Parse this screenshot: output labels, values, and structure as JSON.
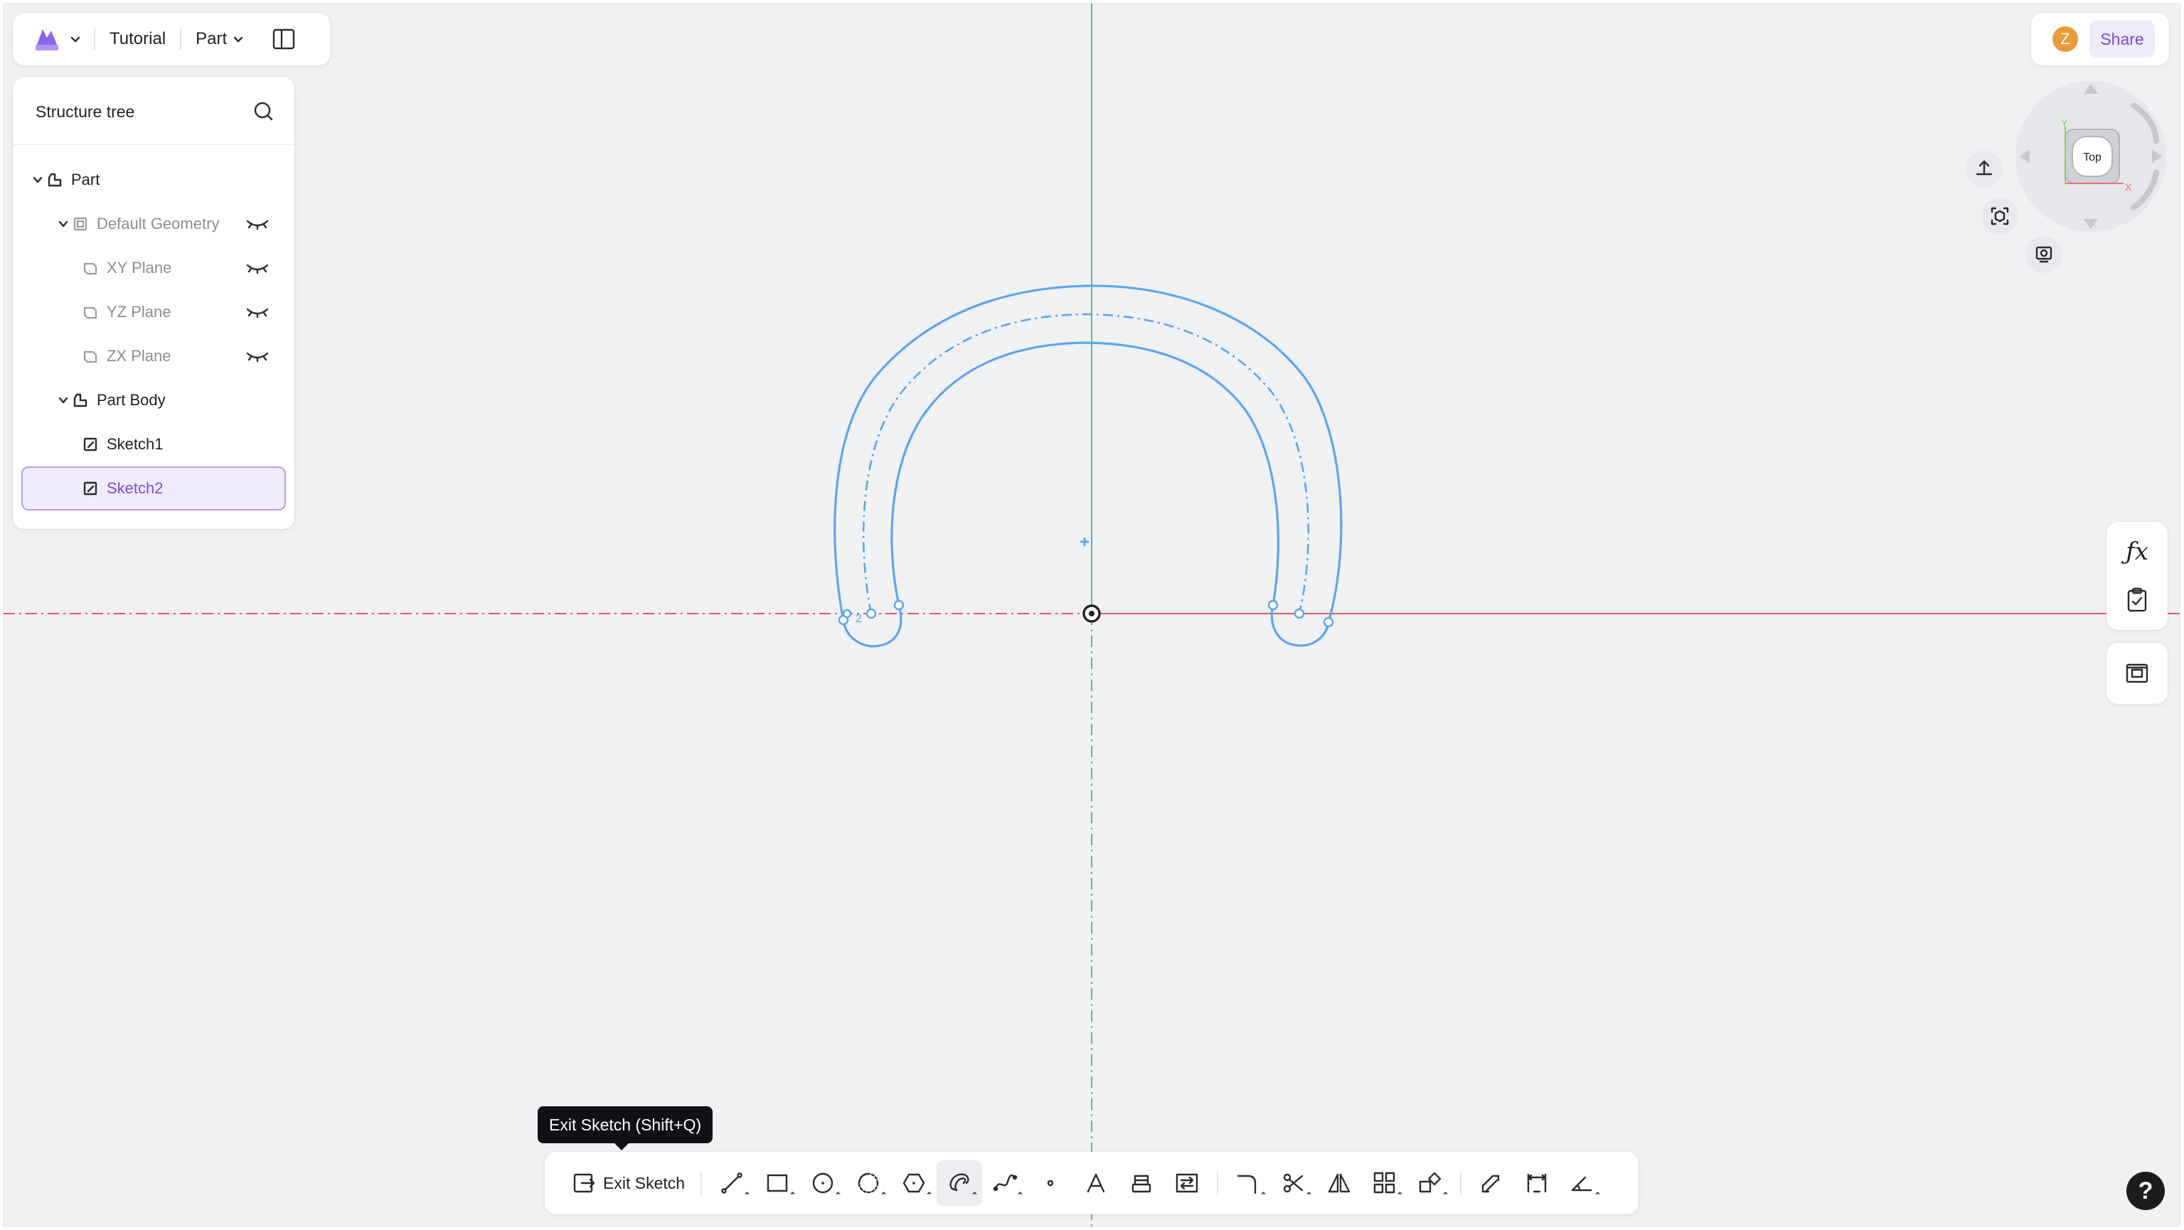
{
  "topbar": {
    "app_logo": "app-logo",
    "project_title": "Tutorial",
    "mode_label": "Part"
  },
  "tree": {
    "title": "Structure tree",
    "items": [
      {
        "label": "Part",
        "icon": "part-icon",
        "expanded": true
      },
      {
        "label": "Default Geometry",
        "icon": "geometry-icon",
        "expanded": true,
        "hidden": true
      },
      {
        "label": "XY Plane",
        "icon": "plane-icon",
        "hidden": true
      },
      {
        "label": "YZ Plane",
        "icon": "plane-icon",
        "hidden": true
      },
      {
        "label": "ZX Plane",
        "icon": "plane-icon",
        "hidden": true
      },
      {
        "label": "Part Body",
        "icon": "body-icon",
        "expanded": true
      },
      {
        "label": "Sketch1",
        "icon": "sketch-icon"
      },
      {
        "label": "Sketch2",
        "icon": "sketch-icon",
        "selected": true
      }
    ]
  },
  "sharebar": {
    "avatar_initial": "Z",
    "share_label": "Share"
  },
  "viewcube": {
    "face_label": "Top",
    "axis_x": "X",
    "axis_y": "Y"
  },
  "sketch": {
    "dimension_label": "2"
  },
  "toolbar": {
    "exit_label": "Exit Sketch",
    "tooltip": "Exit Sketch (Shift+Q)",
    "tools": [
      "line-tool",
      "rectangle-tool",
      "circle-tool",
      "arc-tool",
      "polygon-tool",
      "slot-tool",
      "spline-tool",
      "point-tool",
      "text-tool",
      "project-tool",
      "convert-tool",
      "fillet-tool",
      "trim-tool",
      "mirror-tool",
      "pattern-tool",
      "transform-tool",
      "offset-tool",
      "dimension-tool",
      "constraint-tool"
    ]
  },
  "help_label": "?",
  "colors": {
    "accent": "#7d4ad8",
    "sketch_blue": "#5aa6ef",
    "axis_red": "#e4586f",
    "axis_green": "#4bbf9a",
    "canvas": "#f0f1f3"
  }
}
